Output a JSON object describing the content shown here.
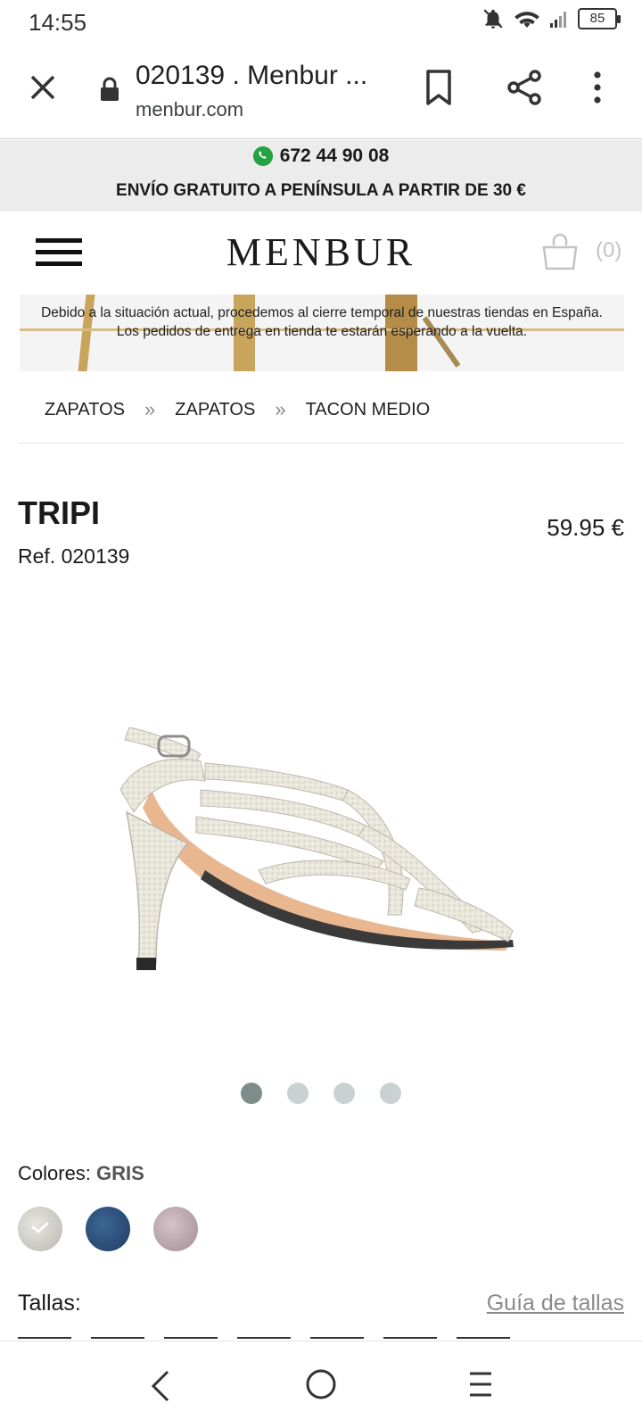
{
  "status_bar": {
    "time": "14:55",
    "battery": "85"
  },
  "browser": {
    "title": "020139 . Menbur ...",
    "url": "menbur.com"
  },
  "promo": {
    "phone": "672 44 90 08",
    "shipping": "ENVÍO GRATUITO A PENÍNSULA A PARTIR DE 30 €"
  },
  "header": {
    "logo": "MENBUR",
    "cart_count": "(0)"
  },
  "notice": {
    "text": "Debido a la situación actual, procedemos al cierre temporal de nuestras tiendas en España. Los pedidos de entrega en tienda te estarán esperando a la vuelta."
  },
  "breadcrumb": {
    "items": [
      "ZAPATOS",
      "ZAPATOS",
      "TACON MEDIO"
    ],
    "separator": "»"
  },
  "product": {
    "name": "TRIPI",
    "ref": "Ref. 020139",
    "price": "59.95 €"
  },
  "gallery": {
    "active_index": 0,
    "total": 4
  },
  "colors": {
    "label": "Colores:",
    "selected": "GRIS",
    "options": [
      "gris",
      "azul",
      "rosa"
    ]
  },
  "sizes": {
    "label": "Tallas:",
    "guide_link": "Guía de tallas"
  },
  "icons": {
    "close": "close-icon",
    "lock": "lock-icon",
    "bookmark": "bookmark-icon",
    "share": "share-icon",
    "more": "more-vert-icon",
    "whatsapp": "whatsapp-icon",
    "menu": "hamburger-icon",
    "cart": "shopping-bag-icon"
  },
  "theme": {
    "promo_bg": "#ececec",
    "dot_active": "#7e8c8a",
    "dot_inactive": "#c9d2d0",
    "whatsapp_green": "#25a244"
  }
}
